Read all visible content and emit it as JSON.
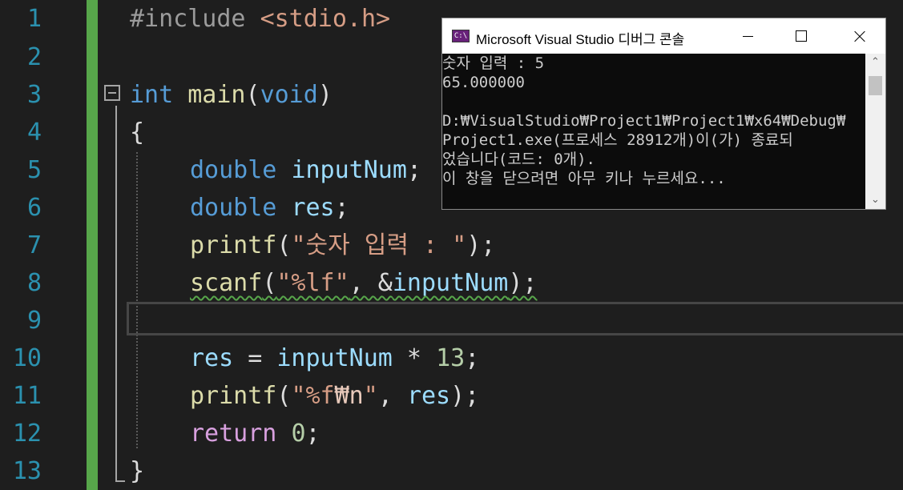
{
  "editor": {
    "line_numbers": [
      "1",
      "2",
      "3",
      "4",
      "5",
      "6",
      "7",
      "8",
      "9",
      "10",
      "11",
      "12",
      "13"
    ],
    "code": {
      "l1_directive": "#include",
      "l1_header": "<stdio.h>",
      "l3_type": "int",
      "l3_name": "main",
      "l3_open": "(",
      "l3_param": "void",
      "l3_close": ")",
      "l4": "{",
      "l5_type": "double",
      "l5_var": "inputNum",
      "l5_semi": ";",
      "l6_type": "double",
      "l6_var": "res",
      "l6_semi": ";",
      "l7_fn": "printf",
      "l7_open": "(",
      "l7_str": "\"숫자 입력 : \"",
      "l7_close": ");",
      "l8_fn": "scanf",
      "l8_open": "(",
      "l8_str": "\"%lf\"",
      "l8_comma": ", &",
      "l8_var": "inputNum",
      "l8_close": ");",
      "l10_var": "res",
      "l10_op": " = ",
      "l10_var2": "inputNum",
      "l10_op2": " * ",
      "l10_num": "13",
      "l10_semi": ";",
      "l11_fn": "printf",
      "l11_open": "(",
      "l11_str1": "\"%f",
      "l11_esc": "₩n",
      "l11_str2": "\"",
      "l11_comma": ", ",
      "l11_var": "res",
      "l11_close": ");",
      "l12_kw": "return",
      "l12_num": "0",
      "l12_semi": ";",
      "l13": "}"
    }
  },
  "console": {
    "icon_text": "C:\\",
    "title": "Microsoft Visual Studio 디버그 콘솔",
    "lines": [
      "숫자 입력 : 5",
      "65.000000",
      "",
      "D:₩VisualStudio₩Project1₩Project1₩x64₩Debug₩",
      "Project1.exe(프로세스 28912개)이(가) 종료되",
      "었습니다(코드: 0개).",
      "이 창을 닫으려면 아무 키나 누르세요..."
    ],
    "scroll_up": "⌃",
    "scroll_down": "⌄"
  },
  "icons": {
    "minimize": "minimize-icon",
    "maximize": "maximize-icon",
    "close": "close-icon"
  },
  "colors": {
    "editor_bg": "#1e1e1e",
    "line_number": "#2b91af",
    "change_bar": "#57a64a",
    "keyword": "#569cd6",
    "function": "#dcdcaa",
    "variable": "#9cdcfe",
    "string": "#d69d85",
    "number": "#b5cea8",
    "control": "#d8a0df",
    "console_bg": "#0c0c0c",
    "console_text": "#cccccc"
  }
}
